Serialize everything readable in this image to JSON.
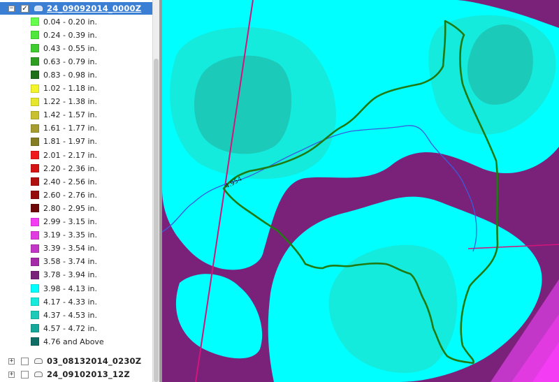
{
  "layers": [
    {
      "name": "24_09092014_0000Z",
      "expander": "−",
      "checked": "✓",
      "selected": true
    },
    {
      "name": "03_08132014_0230Z",
      "expander": "+",
      "checked": "",
      "selected": false
    },
    {
      "name": "24_09102013_12Z",
      "expander": "+",
      "checked": "",
      "selected": false
    }
  ],
  "legend": [
    {
      "label": " 0.04 - 0.20 in.",
      "color": "#66ff4d"
    },
    {
      "label": "0.24 - 0.39 in.",
      "color": "#4ee83a"
    },
    {
      "label": "0.43 - 0.55 in.",
      "color": "#3fcc2e"
    },
    {
      "label": "0.63 - 0.79 in.",
      "color": "#2e9e22"
    },
    {
      "label": "0.83 - 0.98 in.",
      "color": "#1f6e1a"
    },
    {
      "label": "1.02 - 1.18 in.",
      "color": "#f4f42a"
    },
    {
      "label": "1.22 - 1.38 in.",
      "color": "#e6e62a"
    },
    {
      "label": "1.42 - 1.57 in.",
      "color": "#c8c02e"
    },
    {
      "label": "1.61 - 1.77 in.",
      "color": "#a59e2e"
    },
    {
      "label": "1.81 - 1.97 in.",
      "color": "#857d22"
    },
    {
      "label": "2.01 - 2.17 in.",
      "color": "#f01a1a"
    },
    {
      "label": "2.20 - 2.36 in.",
      "color": "#d41414"
    },
    {
      "label": "2.40 - 2.56 in.",
      "color": "#b01010"
    },
    {
      "label": "2.60 - 2.76 in.",
      "color": "#940c0c"
    },
    {
      "label": "2.80 - 2.95 in.",
      "color": "#6e0808"
    },
    {
      "label": "2.99 - 3.15 in.",
      "color": "#f53cf5"
    },
    {
      "label": "3.19 - 3.35 in.",
      "color": "#e03ae0"
    },
    {
      "label": "3.39 - 3.54 in.",
      "color": "#c236c8"
    },
    {
      "label": "3.58 - 3.74 in.",
      "color": "#a52aa8"
    },
    {
      "label": "3.78 - 3.94 in.",
      "color": "#7a227a"
    },
    {
      "label": "3.98 - 4.13 in.",
      "color": "#00ffff"
    },
    {
      "label": "4.17 - 4.33 in.",
      "color": "#14ebdc"
    },
    {
      "label": "4.37 - 4.53 in.",
      "color": "#1ccab9"
    },
    {
      "label": "4.57 - 4.72 in.",
      "color": "#14a89a"
    },
    {
      "label": "4.76 and Above",
      "color": "#0f6e66"
    }
  ],
  "map": {
    "river_label": "4.954",
    "colors": {
      "base_purple": "#7a227a",
      "cyan_light": "#00ffff",
      "cyan_mid": "#14ebdc",
      "cyan_dark": "#1ccab9",
      "cyan_darker": "#14a89a",
      "pink_bright": "#f53cf5",
      "pink_mid": "#e03ae0",
      "pink_dark": "#c236c8",
      "watershed": "#1f7a12",
      "river": "#3b5bdb",
      "road": "#d4147a"
    }
  }
}
